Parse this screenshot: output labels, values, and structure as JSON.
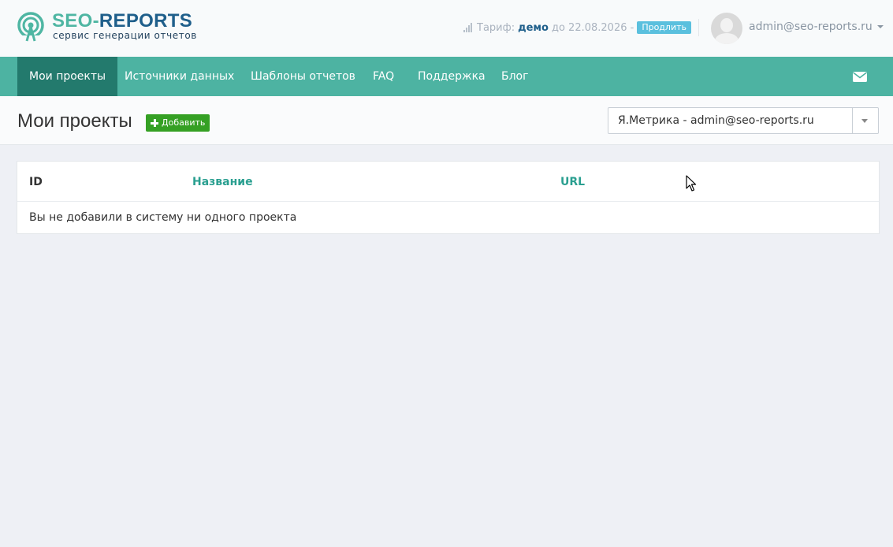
{
  "brand": {
    "name_part1": "SEO-",
    "name_part2": "REPORTS",
    "tagline": "сервис генерации отчетов",
    "colors": {
      "teal": "#4db3a2",
      "dark_teal": "#237a6d",
      "blue": "#1f5f8b"
    }
  },
  "header": {
    "tariff_label": "Тариф:",
    "tariff_plan": "демо",
    "tariff_until": "до 22.08.2026 -",
    "extend_button": "Продлить",
    "user_email": "admin@seo-reports.ru"
  },
  "nav": {
    "items": [
      {
        "label": "Мои проекты",
        "active": true
      },
      {
        "label": "Источники данных",
        "active": false
      },
      {
        "label": "Шаблоны отчетов",
        "active": false
      },
      {
        "label": "FAQ",
        "active": false
      },
      {
        "label": "Поддержка",
        "active": false
      },
      {
        "label": "Блог",
        "active": false
      }
    ],
    "mail_icon": "envelope-icon"
  },
  "page": {
    "title": "Мои проекты",
    "add_button": "Добавить",
    "source_select": {
      "value": "Я.Метрика - admin@seo-reports.ru"
    }
  },
  "table": {
    "columns": [
      "ID",
      "Название",
      "URL"
    ],
    "empty_message": "Вы не добавили в систему ни одного проекта"
  }
}
